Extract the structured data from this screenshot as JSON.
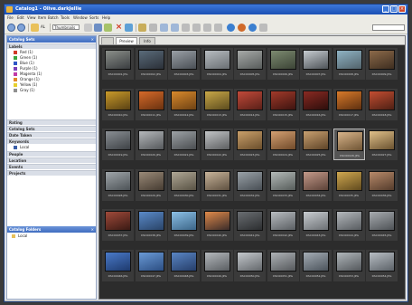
{
  "window": {
    "title": "Catalog1 - Olive.darkJellie",
    "controls": {
      "minimize": "_",
      "maximize": "□",
      "close": "×"
    }
  },
  "menu": [
    "File",
    "Edit",
    "View",
    "Item",
    "Batch",
    "Tools",
    "Window",
    "Sorts",
    "Help"
  ],
  "toolbar": {
    "mode_label": "AL",
    "zoom_value": "Thumbnails",
    "icons": [
      "back-icon",
      "forward-icon",
      "import-icon",
      "delete-icon",
      "rotate-icon",
      "filter-icon",
      "play-icon",
      "refresh-icon",
      "settings-icon"
    ]
  },
  "sidebar": {
    "panel1_title": "Catalog Sets",
    "panel1_close": "×",
    "panel2_title": "Catalog Folders",
    "panel2_close": "×",
    "categories_header": "Labels",
    "categories": [
      {
        "label": "Red (1)",
        "color": "#d13b2a"
      },
      {
        "label": "Green (1)",
        "color": "#3aa640"
      },
      {
        "label": "Blue (1)",
        "color": "#2f56c6"
      },
      {
        "label": "Purple (1)",
        "color": "#7b3fb8"
      },
      {
        "label": "Magenta (1)",
        "color": "#c23aa8"
      },
      {
        "label": "Orange (1)",
        "color": "#e2882a"
      },
      {
        "label": "Yellow (1)",
        "color": "#e6cf2e"
      },
      {
        "label": "Gray (1)",
        "color": "#909090"
      }
    ],
    "groups": [
      "Rating",
      "Catalog Sets",
      "Date Taken",
      "Keywords",
      "People",
      "Location",
      "Events",
      "Projects"
    ],
    "folder_item": "Local"
  },
  "tabs": [
    "",
    "Preview",
    "Info"
  ],
  "thumbnails": [
    [
      {
        "caption": "DSC00001.JPG",
        "colors": [
          "#8b8f8a",
          "#3a3d40"
        ]
      },
      {
        "caption": "DSC00002.JPG",
        "colors": [
          "#5a6b7a",
          "#2b3038"
        ]
      },
      {
        "caption": "DSC00003.JPG",
        "colors": [
          "#9aa0a6",
          "#4a4f55"
        ]
      },
      {
        "caption": "DSC00004.JPG",
        "colors": [
          "#b7bcc0",
          "#6a6f73"
        ]
      },
      {
        "caption": "DSC00005.JPG",
        "colors": [
          "#a7aaa8",
          "#585c5b"
        ]
      },
      {
        "caption": "DSC00006.JPG",
        "colors": [
          "#7c8a70",
          "#3c4436"
        ]
      },
      {
        "caption": "DSC00007.JPG",
        "colors": [
          "#c6cbd0",
          "#4e5358"
        ]
      },
      {
        "caption": "DSC00008.JPG",
        "colors": [
          "#8fb3c4",
          "#52636b"
        ]
      },
      {
        "caption": "DSC00009.JPG",
        "colors": [
          "#8c6a4a",
          "#3e2e20"
        ]
      }
    ],
    [
      {
        "caption": "DSC00010.JPG",
        "colors": [
          "#c99a2a",
          "#5a4214"
        ]
      },
      {
        "caption": "DSC00011.JPG",
        "colors": [
          "#d66a2a",
          "#6a3210"
        ]
      },
      {
        "caption": "DSC00012.JPG",
        "colors": [
          "#d98a2c",
          "#6e4214"
        ]
      },
      {
        "caption": "DSC00013.JPG",
        "colors": [
          "#c9a848",
          "#5c4c1e"
        ]
      },
      {
        "caption": "DSC00014.JPG",
        "colors": [
          "#c24a3a",
          "#5a2018"
        ]
      },
      {
        "caption": "DSC00015.JPG",
        "colors": [
          "#a23a2a",
          "#3e1410"
        ]
      },
      {
        "caption": "DSC00016.JPG",
        "colors": [
          "#8a2a22",
          "#2e0e0c"
        ]
      },
      {
        "caption": "DSC00017.JPG",
        "colors": [
          "#d87a2a",
          "#5e3010"
        ]
      },
      {
        "caption": "DSC00018.JPG",
        "colors": [
          "#c44e32",
          "#4e2014"
        ]
      }
    ],
    [
      {
        "caption": "DSC00019.JPG",
        "colors": [
          "#8a8f94",
          "#3e4246"
        ]
      },
      {
        "caption": "DSC00020.JPG",
        "colors": [
          "#b5b8bb",
          "#55585b"
        ]
      },
      {
        "caption": "DSC00021.JPG",
        "colors": [
          "#9da2a6",
          "#4a4d50"
        ]
      },
      {
        "caption": "DSC00022.JPG",
        "colors": [
          "#c2c4c6",
          "#5c5e60"
        ]
      },
      {
        "caption": "DSC00023.JPG",
        "colors": [
          "#caa06a",
          "#6a4e2c"
        ]
      },
      {
        "caption": "DSC00024.JPG",
        "colors": [
          "#d4a072",
          "#704a2a"
        ]
      },
      {
        "caption": "DSC00025.JPG",
        "colors": [
          "#c8a070",
          "#5e4428"
        ]
      },
      {
        "caption": "DSC00026.JPG",
        "colors": [
          "#d8b48a",
          "#6e5434"
        ]
      },
      {
        "caption": "DSC00027.JPG",
        "colors": [
          "#e0c08a",
          "#6a5230"
        ]
      }
    ],
    [
      {
        "caption": "DSC00028.JPG",
        "colors": [
          "#a0a6aa",
          "#4c5256"
        ]
      },
      {
        "caption": "DSC00029.JPG",
        "colors": [
          "#9a8a78",
          "#463c32"
        ]
      },
      {
        "caption": "DSC00030.JPG",
        "colors": [
          "#b0a896",
          "#585244"
        ]
      },
      {
        "caption": "DSC00031.JPG",
        "colors": [
          "#c8b49a",
          "#5e5040"
        ]
      },
      {
        "caption": "DSC00032.JPG",
        "colors": [
          "#9aa2a8",
          "#484e54"
        ]
      },
      {
        "caption": "DSC00033.JPG",
        "colors": [
          "#b4bab8",
          "#565c5a"
        ]
      },
      {
        "caption": "DSC00034.JPG",
        "colors": [
          "#c49a8a",
          "#5c4238"
        ]
      },
      {
        "caption": "DSC00035.JPG",
        "colors": [
          "#d0a850",
          "#604a1e"
        ]
      },
      {
        "caption": "DSC00036.JPG",
        "colors": [
          "#b88a6a",
          "#543c2c"
        ]
      }
    ],
    [
      {
        "caption": "DSC00037.JPG",
        "colors": [
          "#a04a3a",
          "#3a1a14"
        ]
      },
      {
        "caption": "DSC00038.JPG",
        "colors": [
          "#5a8ac8",
          "#2a4468"
        ]
      },
      {
        "caption": "DSC00039.JPG",
        "colors": [
          "#8cc0e6",
          "#3c6688"
        ]
      },
      {
        "caption": "DSC00040.JPG",
        "colors": [
          "#e08a4a",
          "#3a2c2a"
        ]
      },
      {
        "caption": "DSC00041.JPG",
        "colors": [
          "#6a6e72",
          "#2c2e30"
        ]
      },
      {
        "caption": "DSC00042.JPG",
        "colors": [
          "#b8bcc0",
          "#5a5e62"
        ]
      },
      {
        "caption": "DSC00043.JPG",
        "colors": [
          "#c8ccd0",
          "#6c7074"
        ]
      },
      {
        "caption": "DSC00044.JPG",
        "colors": [
          "#b4b8bc",
          "#585c60"
        ]
      },
      {
        "caption": "DSC00045.JPG",
        "colors": [
          "#a8acb0",
          "#4e5256"
        ]
      }
    ],
    [
      {
        "caption": "DSC00046.JPG",
        "colors": [
          "#4a7ac8",
          "#1e3a6e"
        ]
      },
      {
        "caption": "DSC00047.JPG",
        "colors": [
          "#6a9ad6",
          "#2c4e82"
        ]
      },
      {
        "caption": "DSC00048.JPG",
        "colors": [
          "#5a86c4",
          "#263e6a"
        ]
      },
      {
        "caption": "DSC00049.JPG",
        "colors": [
          "#b4b8bc",
          "#5a5e62"
        ]
      },
      {
        "caption": "DSC00050.JPG",
        "colors": [
          "#c4c8cc",
          "#64686c"
        ]
      },
      {
        "caption": "DSC00051.JPG",
        "colors": [
          "#aeb2b6",
          "#56595c"
        ]
      },
      {
        "caption": "DSC00052.JPG",
        "colors": [
          "#a4acb4",
          "#4c545c"
        ]
      },
      {
        "caption": "DSC00053.JPG",
        "colors": [
          "#b0b6ba",
          "#54585c"
        ]
      },
      {
        "caption": "DSC00054.JPG",
        "colors": [
          "#b8bec4",
          "#5c6268"
        ]
      }
    ]
  ]
}
